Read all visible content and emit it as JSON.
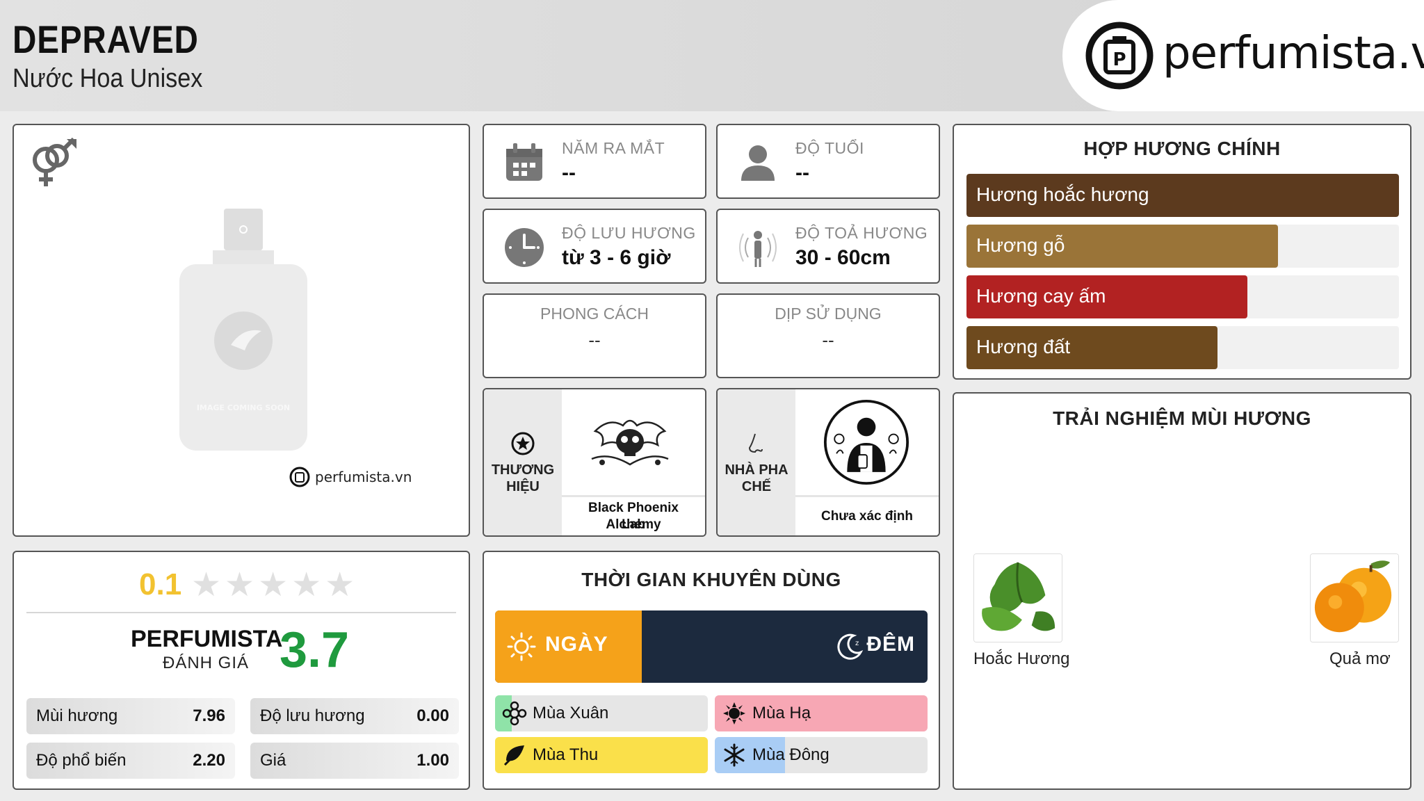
{
  "header": {
    "title": "DEPRAVED",
    "subtitle": "Nước Hoa Unisex",
    "logo_text": "perfumista.vn"
  },
  "image_card": {
    "gender_icon": "unisex-icon",
    "bottle_caption": "IMAGE COMING SOON",
    "watermark": "perfumista.vn"
  },
  "info": {
    "release_year": {
      "label": "NĂM RA MẮT",
      "value": "--",
      "icon": "calendar-icon"
    },
    "age": {
      "label": "ĐỘ TUỔI",
      "value": "--",
      "icon": "person-icon"
    },
    "longevity": {
      "label": "ĐỘ LƯU HƯƠNG",
      "value": "từ 3 - 6 giờ",
      "icon": "clock-icon"
    },
    "sillage": {
      "label": "ĐỘ TOẢ HƯƠNG",
      "value": "30 - 60cm",
      "icon": "sillage-icon"
    },
    "style": {
      "label": "PHONG CÁCH",
      "value": "--"
    },
    "occasion": {
      "label": "DỊP SỬ DỤNG",
      "value": "--"
    }
  },
  "brand": {
    "label_line1": "THƯƠNG",
    "label_line2": "HIỆU",
    "name_line1": "Black Phoenix Alchemy",
    "name_line2": "Lab",
    "icon": "star-circle-icon"
  },
  "perfumer": {
    "label_line1": "NHÀ PHA",
    "label_line2": "CHẾ",
    "name": "Chưa xác định",
    "icon": "nose-icon"
  },
  "accords": {
    "title": "HỢP HƯƠNG CHÍNH",
    "items": [
      {
        "label": "Hương hoắc hương",
        "strength": 1.0,
        "color": "#5c3a1e"
      },
      {
        "label": "Hương gỗ",
        "strength": 0.72,
        "color": "#9a7438"
      },
      {
        "label": "Hương cay ấm",
        "strength": 0.65,
        "color": "#b22222"
      },
      {
        "label": "Hương đất",
        "strength": 0.58,
        "color": "#6e4a1e"
      }
    ]
  },
  "notes": {
    "title": "TRẢI NGHIỆM MÙI HƯƠNG",
    "items": [
      {
        "label": "Hoắc Hương",
        "icon": "patchouli-leaf-icon"
      },
      {
        "label": "Quả mơ",
        "icon": "apricot-icon"
      }
    ]
  },
  "rating": {
    "user_score": "0.1",
    "user_stars_filled": 0.02,
    "star_count": 5,
    "perfumista_label": "PERFUMISTA",
    "perfumista_sub": "ĐÁNH GIÁ",
    "perfumista_score": "3.7",
    "metrics": [
      {
        "label": "Mùi hương",
        "value": "7.96"
      },
      {
        "label": "Độ lưu hương",
        "value": "0.00"
      },
      {
        "label": "Độ phổ biến",
        "value": "2.20"
      },
      {
        "label": "Giá",
        "value": "1.00"
      }
    ]
  },
  "time": {
    "title": "THỜI GIAN KHUYÊN DÙNG",
    "day_label": "NGÀY",
    "night_label": "ĐÊM",
    "day_fraction": 0.34,
    "seasons": [
      {
        "label": "Mùa Xuân",
        "fraction": 0.08,
        "color": "#8fe3a8",
        "icon": "spring-flower-icon"
      },
      {
        "label": "Mùa Hạ",
        "fraction": 1.0,
        "color": "#f7a7b4",
        "icon": "sun-icon"
      },
      {
        "label": "Mùa Thu",
        "fraction": 1.0,
        "color": "#fae04a",
        "icon": "leaf-icon"
      },
      {
        "label": "Mùa Đông",
        "fraction": 0.33,
        "color": "#a9cdf5",
        "icon": "snowflake-icon"
      }
    ]
  }
}
